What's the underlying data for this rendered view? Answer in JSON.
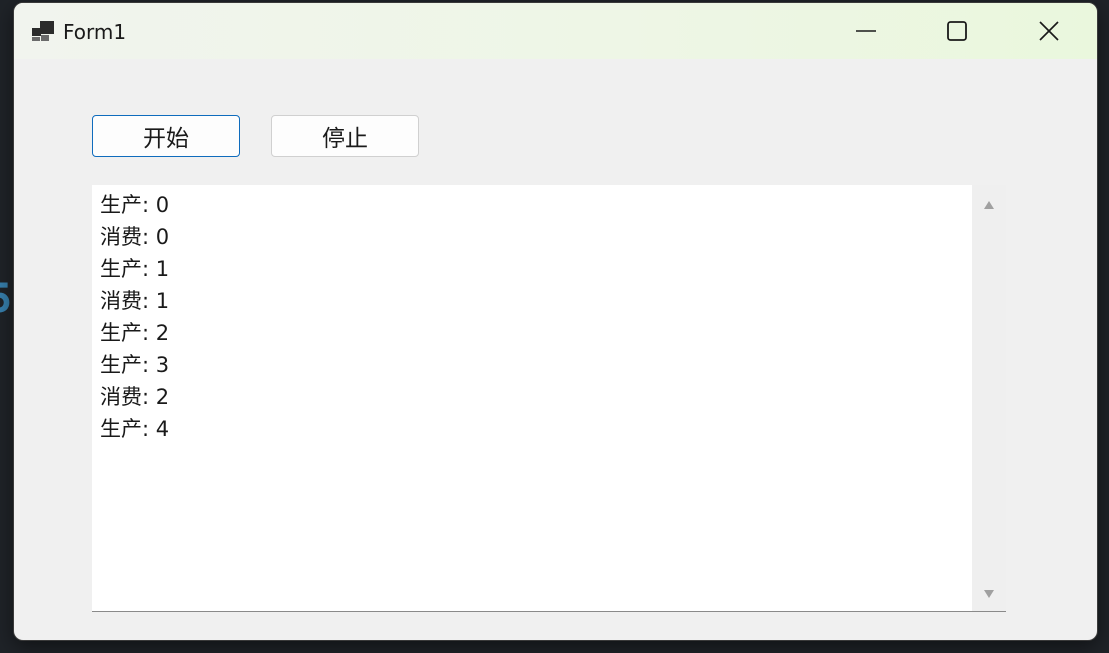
{
  "window": {
    "title": "Form1",
    "icon": "winforms-app-icon",
    "controls": {
      "minimize": "minimize-icon",
      "maximize": "maximize-icon",
      "close": "close-icon"
    }
  },
  "toolbar": {
    "start_label": "开始",
    "stop_label": "停止"
  },
  "log": {
    "items": [
      "生产: 0",
      "消费: 0",
      "生产: 1",
      "消费: 1",
      "生产: 2",
      "生产: 3",
      "消费: 2",
      "生产: 4"
    ]
  },
  "colors": {
    "focus_border": "#0f6cbd",
    "window_bg": "#f0f0f0",
    "list_bg": "#ffffff"
  }
}
